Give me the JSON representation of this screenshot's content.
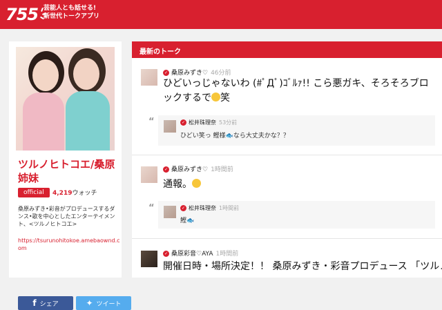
{
  "header": {
    "logo_text": "755",
    "tagline_1": "芸能人とも話せる!",
    "tagline_2": "新世代トークアプリ"
  },
  "profile": {
    "name": "ツルノヒトコエ/桑原姉妹",
    "badge": "official",
    "watch_count": "4,219",
    "watch_label": "ウォッチ",
    "description": "桑原みずき•彩音がプロデュースするダンス•歌を中心としたエンターテイメント、<ツルノヒトコエ>",
    "url": "https://tsurunohitokoe.amebaownd.com",
    "share_fb": "シェア",
    "share_tw": "ツイート"
  },
  "talk": {
    "section_title": "最新のトーク",
    "posts": [
      {
        "user": "桑原みずき♡",
        "time": "46分前",
        "text": "ひどいっじゃないわ (#ﾟДﾟ)ｺﾞﾙｧ!! こら悪ガキ、そろそろブロックするで",
        "text_end": "笑",
        "reply": {
          "user": "松井珠理奈",
          "time": "53分前",
          "text": "ひどい笑っ 鰹様",
          "text_end": "なら大丈夫かな？？"
        }
      },
      {
        "user": "桑原みずき♡",
        "time": "1時間前",
        "text": "通報。",
        "reply": {
          "user": "松井珠理奈",
          "time": "1時間前",
          "text": "鰹"
        }
      },
      {
        "user": "桑原彩音♡AYA",
        "time": "1時間前",
        "text": "開催日時・場所決定！！ 桑原みずき・彩音プロデュース 「ツルノヒ"
      }
    ]
  }
}
